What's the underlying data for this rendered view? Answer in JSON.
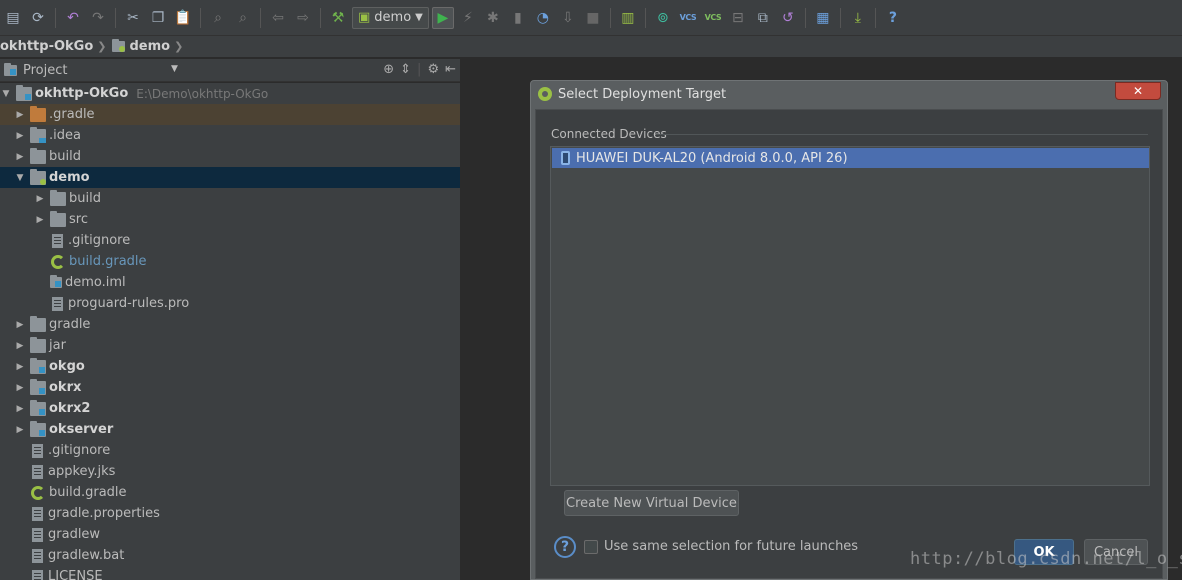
{
  "toolbar": {
    "run_config_label": "demo"
  },
  "breadcrumb": {
    "items": [
      "okhttp-OkGo",
      "demo"
    ]
  },
  "project_panel": {
    "title": "Project"
  },
  "tree": {
    "root": {
      "label": "okhttp-OkGo",
      "path": "E:\\Demo\\okhttp-OkGo"
    },
    "rows": [
      ".gradle",
      ".idea",
      "build",
      "demo",
      "build",
      "src",
      ".gitignore",
      "build.gradle",
      "demo.iml",
      "proguard-rules.pro",
      "gradle",
      "jar",
      "okgo",
      "okrx",
      "okrx2",
      "okserver",
      ".gitignore",
      "appkey.jks",
      "build.gradle",
      "gradle.properties",
      "gradlew",
      "gradlew.bat",
      "LICENSE"
    ]
  },
  "dialog": {
    "title": "Select Deployment Target",
    "close_label": "✕",
    "section_label": "Connected Devices",
    "device": "HUAWEI DUK-AL20 (Android 8.0.0, API 26)",
    "create_button": "Create New Virtual Device",
    "help_label": "?",
    "checkbox_label": "Use same selection for future launches",
    "ok_label": "OK",
    "cancel_label": "Cancel"
  },
  "watermark": "http://blog.csdn.net/l_o_s",
  "colors": {
    "selection": "#4b6eaf",
    "tree_selected_row": "#0d293e",
    "ok_button": "#365880",
    "close_button": "#c34b3e"
  }
}
